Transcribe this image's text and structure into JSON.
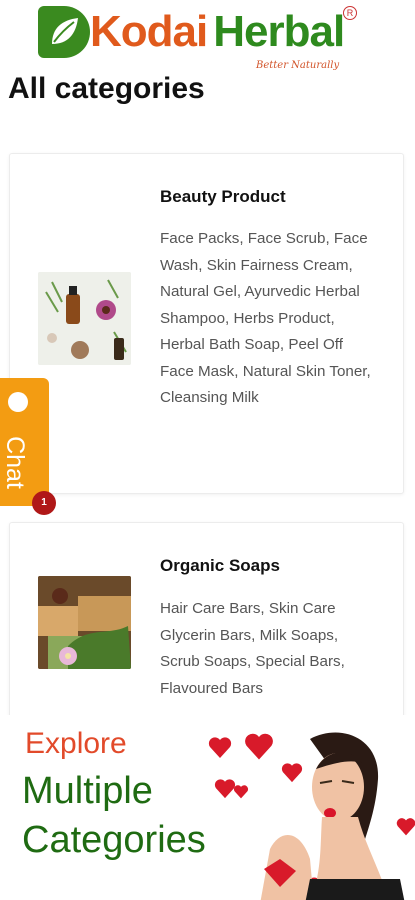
{
  "brand": {
    "name_part1": "Kodai",
    "name_part2": "Herbal",
    "registered": "R",
    "tagline": "Better Naturally",
    "primary_green": "#2e8a1e",
    "accent_orange": "#e05a1c"
  },
  "page": {
    "title": "All categories"
  },
  "categories": [
    {
      "title": "Beauty Product",
      "description": "Face Packs, Face Scrub, Face Wash, Skin Fairness Cream, Natural Gel, Ayurvedic Herbal Shampoo, Herbs Product, Herbal Bath Soap, Peel Off Face Mask, Natural Skin Toner, Cleansing Milk"
    },
    {
      "title": "Organic Soaps",
      "description": "Hair Care Bars, Skin Care Glycerin Bars, Milk Soaps, Scrub Soaps, Special Bars, Flavoured Bars"
    }
  ],
  "chat": {
    "label": "Chat",
    "badge_count": "1",
    "color": "#f39c12"
  },
  "promo": {
    "line1": "Explore",
    "line2": "Multiple",
    "line3": "Categories"
  }
}
